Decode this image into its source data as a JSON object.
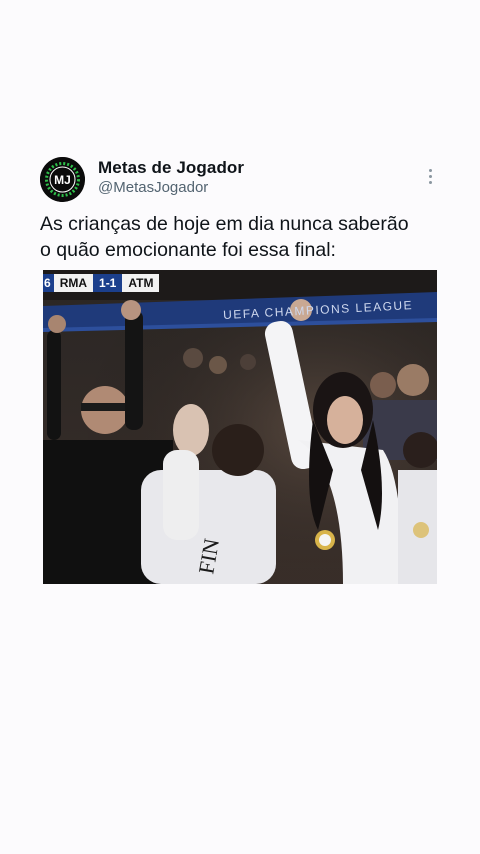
{
  "tweet": {
    "display_name": "Metas de Jogador",
    "handle": "@MetasJogador",
    "text": "As crianças de hoje em dia nunca saberão\no quão emocionante foi essa final:",
    "more_icon": "more-vertical-icon",
    "avatar_icon": "mj-logo-icon",
    "avatar_letters": "MJ",
    "accent": "#2fbf4a"
  },
  "media": {
    "scorebug": {
      "minute": "6",
      "home": "RMA",
      "score": "1-1",
      "away": "ATM"
    },
    "banner": "UEFA CHAMPIONS LEAGUE"
  }
}
